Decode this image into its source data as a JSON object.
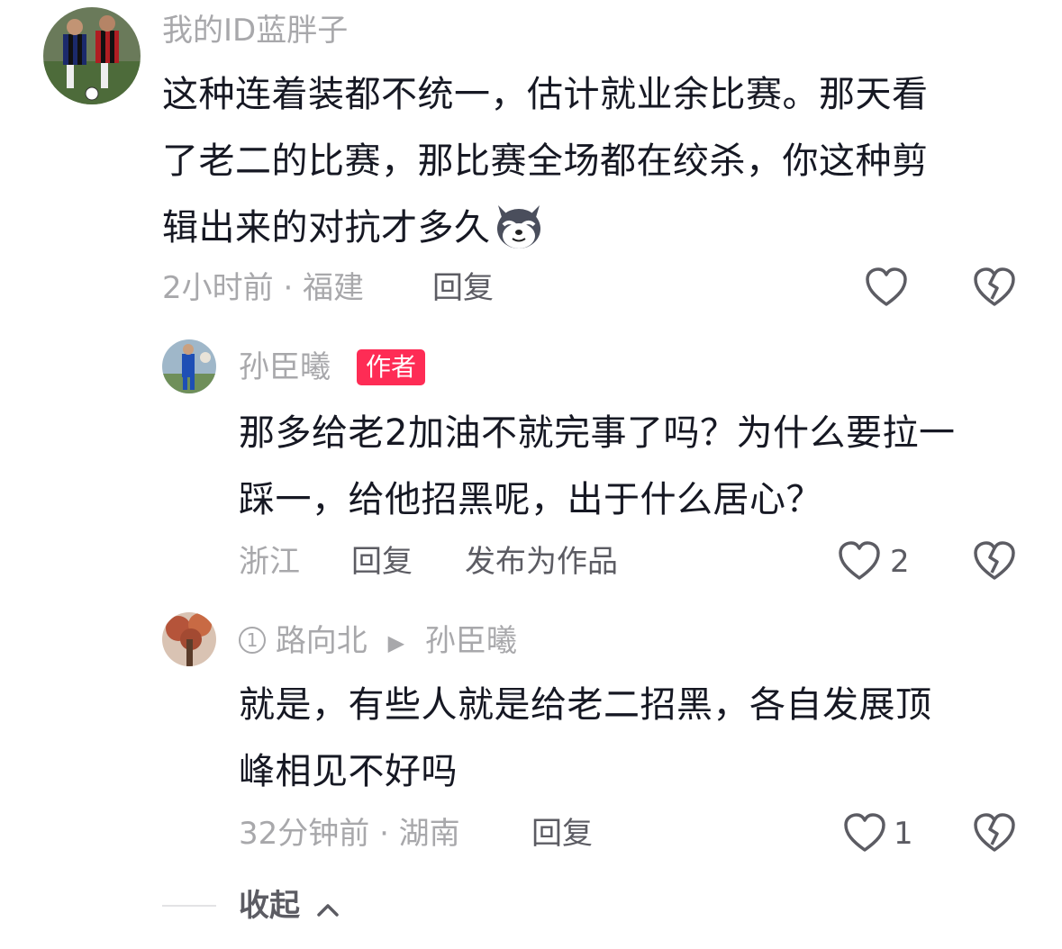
{
  "comment": {
    "username": "我的ID蓝胖子",
    "text_line1": "这种连着装都不统一，估计就业余比赛。那天看",
    "text_line2": "了老二的比赛，那比赛全场都在绞杀，你这种剪",
    "text_line3": "辑出来的对抗才多久",
    "emoji": "husky-smirk-emoji",
    "meta": "2小时前 · 福建",
    "reply_label": "回复"
  },
  "reply1": {
    "username": "孙臣曦",
    "badge": "作者",
    "text_line1": "那多给老2加油不就完事了吗？为什么要拉一",
    "text_line2": "踩一，给他招黑呢，出于什么居心？",
    "meta": "浙江",
    "reply_label": "回复",
    "publish_label": "发布为作品",
    "like_count": "2"
  },
  "reply2": {
    "badge_num": "1",
    "username": "路向北",
    "reply_to": "孙臣曦",
    "text_line1": "就是，有些人就是给老二招黑，各自发展顶",
    "text_line2": "峰相见不好吗",
    "meta": "32分钟前 · 湖南",
    "reply_label": "回复",
    "like_count": "1"
  },
  "collapse_label": "收起",
  "colors": {
    "author_badge": "#fe2c55",
    "secondary_text": "#a8a8ab",
    "primary_text": "#161823"
  }
}
